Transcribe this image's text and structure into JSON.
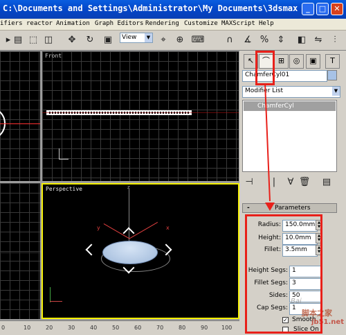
{
  "window": {
    "title": "C:\\Documents and Settings\\Administrator\\My Documents\\3dsmax"
  },
  "menu": [
    "ifiers",
    "reactor",
    "Animation",
    "Graph Editors",
    "Rendering",
    "Customize",
    "MAXScript",
    "Help"
  ],
  "toolbar": {
    "view_select": "View"
  },
  "viewports": {
    "front": {
      "label": "Front"
    },
    "perspective": {
      "label": "Perspective",
      "axis_z": "z",
      "axis_x": "x",
      "axis_y": "y"
    }
  },
  "panel": {
    "object_name": "ChamferCyl01",
    "modifier_list": "Modifier List",
    "stack_item": "ChamferCyl",
    "rollout_toggle": "-",
    "rollout_title": "Parameters",
    "params": [
      {
        "label": "Radius:",
        "value": "150.0mm"
      },
      {
        "label": "Height:",
        "value": "10.0mm"
      },
      {
        "label": "Fillet:",
        "value": "3.5mm"
      },
      {
        "label": "Height Segs:",
        "value": "1"
      },
      {
        "label": "Fillet Segs:",
        "value": "3"
      },
      {
        "label": "Sides:",
        "value": "50"
      },
      {
        "label": "Cap Segs:",
        "value": "1"
      }
    ],
    "smooth_label": "Smooth",
    "smooth_checked": true,
    "slice_on_label": "Slice On"
  },
  "timeline": {
    "ticks": [
      "0",
      "10",
      "20",
      "30",
      "40",
      "50",
      "60",
      "70",
      "80",
      "90",
      "100"
    ]
  },
  "watermark": {
    "site": "脚本之家",
    "url": "jb51.net",
    "baidu": "Bai"
  },
  "colors": {
    "title_bar": "#0346c8",
    "highlight": "#e8201a",
    "viewport_bg": "#000000",
    "selected_object": "#b8cfe8",
    "active_viewport_border": "#f5f000"
  }
}
